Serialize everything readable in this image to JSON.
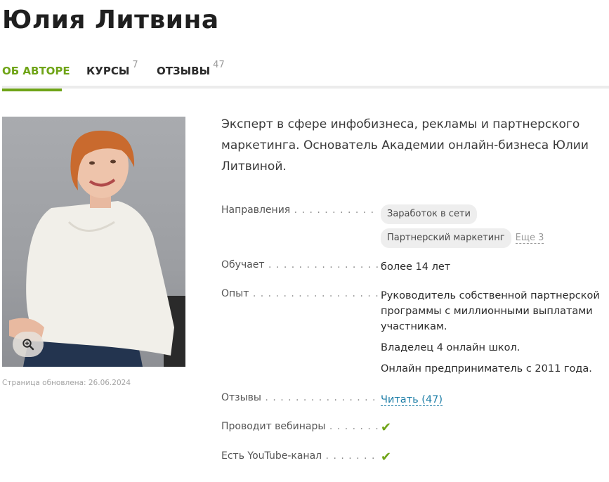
{
  "page": {
    "title": "Юлия Литвина",
    "updated": "Страница обновлена: 26.06.2024"
  },
  "tabs": [
    {
      "label": "ОБ АВТОРЕ",
      "count": "",
      "active": true
    },
    {
      "label": "КУРСЫ",
      "count": "7",
      "active": false
    },
    {
      "label": "ОТЗЫВЫ",
      "count": "47",
      "active": false
    }
  ],
  "intro": "Эксперт в сфере инфобизнеса, рекламы и партнерского маркетинга. Основатель Академии онлайн-бизнеса Юлии Литвиной.",
  "details": {
    "directions": {
      "label": "Направления",
      "tags": [
        "Заработок в сети",
        "Партнерский маркетинг"
      ],
      "more": "Еще 3"
    },
    "teaches": {
      "label": "Обучает",
      "value": "более 14 лет"
    },
    "experience": {
      "label": "Опыт",
      "items": [
        "Руководитель собственной партнерской программы с миллионными выплатами участникам.",
        "Владелец 4 онлайн школ.",
        "Онлайн предприниматель с 2011 года."
      ]
    },
    "reviews": {
      "label": "Отзывы",
      "link": "Читать (47)"
    },
    "webinars": {
      "label": "Проводит вебинары",
      "value": "✔"
    },
    "youtube": {
      "label": "Есть YouTube-канал",
      "value": "✔"
    }
  },
  "colors": {
    "accent": "#6fa417",
    "link": "#1f7fa8"
  },
  "icons": {
    "zoom": "magnifier-plus-icon",
    "check": "check-icon"
  }
}
